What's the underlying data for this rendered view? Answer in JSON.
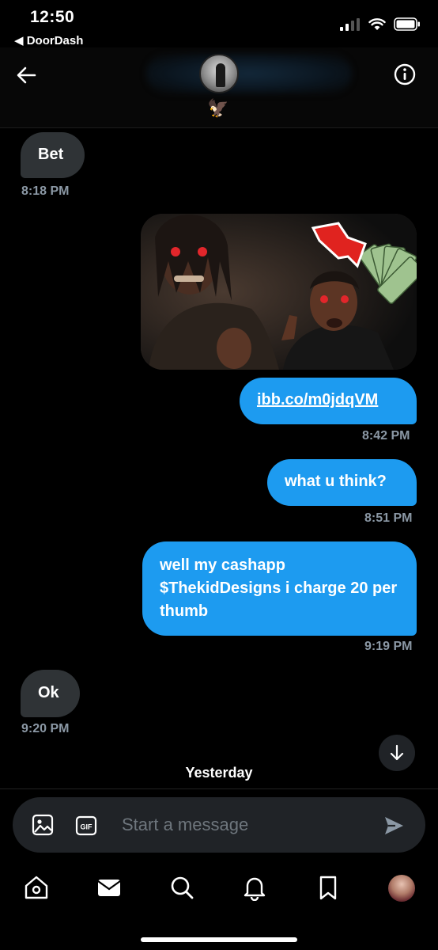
{
  "status_bar": {
    "time": "12:50",
    "back_app": "◀ DoorDash"
  },
  "header": {
    "avatar_icon": "profile-avatar",
    "badge_icon": "eagle-emoji",
    "badge_glyph": "🦅"
  },
  "messages": [
    {
      "direction": "received",
      "text": "Bet",
      "time": "8:18 PM"
    },
    {
      "direction": "sent",
      "type": "image",
      "time": ""
    },
    {
      "direction": "sent",
      "text": "ibb.co/m0jdqVM",
      "link": true,
      "time": "8:42 PM"
    },
    {
      "direction": "sent",
      "text": "what u think?",
      "time": "8:51 PM"
    },
    {
      "direction": "sent",
      "text": "well my cashapp $ThekidDesigns i charge 20 per thumb",
      "time": "9:19 PM"
    },
    {
      "direction": "received",
      "text": "Ok",
      "time": "9:20 PM"
    }
  ],
  "day_separator": "Yesterday",
  "composer": {
    "placeholder": "Start a message",
    "gif_label": "GIF"
  },
  "tabs": [
    "home",
    "messages",
    "search",
    "notifications",
    "bookmarks",
    "profile"
  ],
  "colors": {
    "accent": "#1d9bf0",
    "received_bubble": "#2f3336",
    "timestamp": "#8b98a5",
    "background": "#000000"
  }
}
